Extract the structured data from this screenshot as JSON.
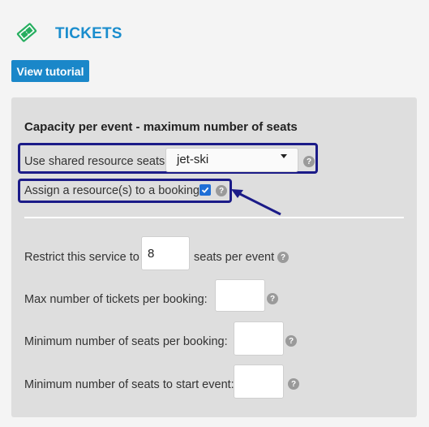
{
  "header": {
    "title": "TICKETS",
    "icon": "ticket-icon",
    "accent_color": "#1a8dcd",
    "icon_color": "#27ae60"
  },
  "tutorial_button": {
    "label": "View tutorial",
    "color": "#1a87c9"
  },
  "panel": {
    "section_title": "Capacity per event - maximum number of seats",
    "shared_resource": {
      "label": "Use shared resource seats",
      "selected": "jet-ski"
    },
    "assign_resource": {
      "label": "Assign a resource(s) to a booking",
      "checked": true
    },
    "restrict": {
      "prefix": "Restrict this service to",
      "value": "8",
      "suffix": "seats per event"
    },
    "max_tickets": {
      "label": "Max number of tickets per booking:",
      "value": ""
    },
    "min_seats_booking": {
      "label": "Minimum number of seats per booking:",
      "value": ""
    },
    "min_seats_start": {
      "label": "Minimum number of seats to start event:",
      "value": ""
    },
    "help_glyph": "?"
  },
  "annotation": {
    "highlight_color": "#1b1b88"
  }
}
